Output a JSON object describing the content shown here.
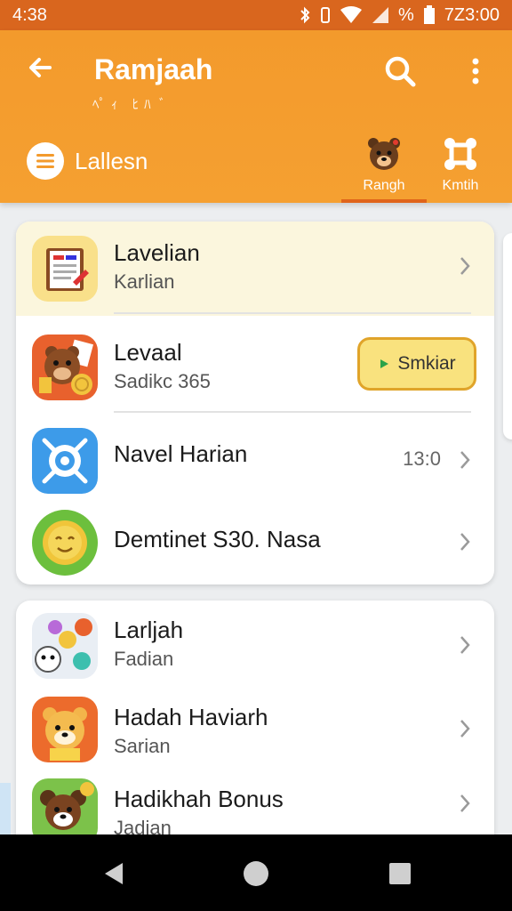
{
  "status_bar": {
    "time": "4:38",
    "right_text": "7Z3:00",
    "percent": "%"
  },
  "appbar": {
    "title": "Ramjaah",
    "subtitle": "ﾍﾟｨ ﾋﾊ ﾞ",
    "filter_label": "Lallesn",
    "tabs": [
      {
        "label": "Rangh",
        "icon": "bear-face-icon",
        "active": true
      },
      {
        "label": "Kmtih",
        "icon": "crossed-arrows-icon",
        "active": false
      }
    ]
  },
  "card1": {
    "rows": [
      {
        "title": "Lavelian",
        "subtitle": "Karlian",
        "icon": "notebook-icon"
      },
      {
        "title": "Levaal",
        "subtitle": "Sadikc 365",
        "icon": "bear-with-coins-icon",
        "button_label": "Smkiar"
      },
      {
        "title": "Navel Harian",
        "value": "13:0",
        "icon": "target-blue-icon"
      },
      {
        "title": "Demtinet S30. Nasa",
        "icon": "coin-face-icon"
      }
    ]
  },
  "card2": {
    "rows": [
      {
        "title": "Larljah",
        "subtitle": "Fadian",
        "icon": "animals-collage-icon"
      },
      {
        "title": "Hadah Haviarh",
        "subtitle": "Sarian",
        "icon": "fox-face-icon"
      },
      {
        "title": "Hadikhah Bonus",
        "subtitle": "Jadian",
        "icon": "dog-bonus-icon"
      }
    ]
  },
  "colors": {
    "accent": "#f39a2c",
    "highlight": "#fbf6dd",
    "button_fill": "#f9e27e"
  }
}
